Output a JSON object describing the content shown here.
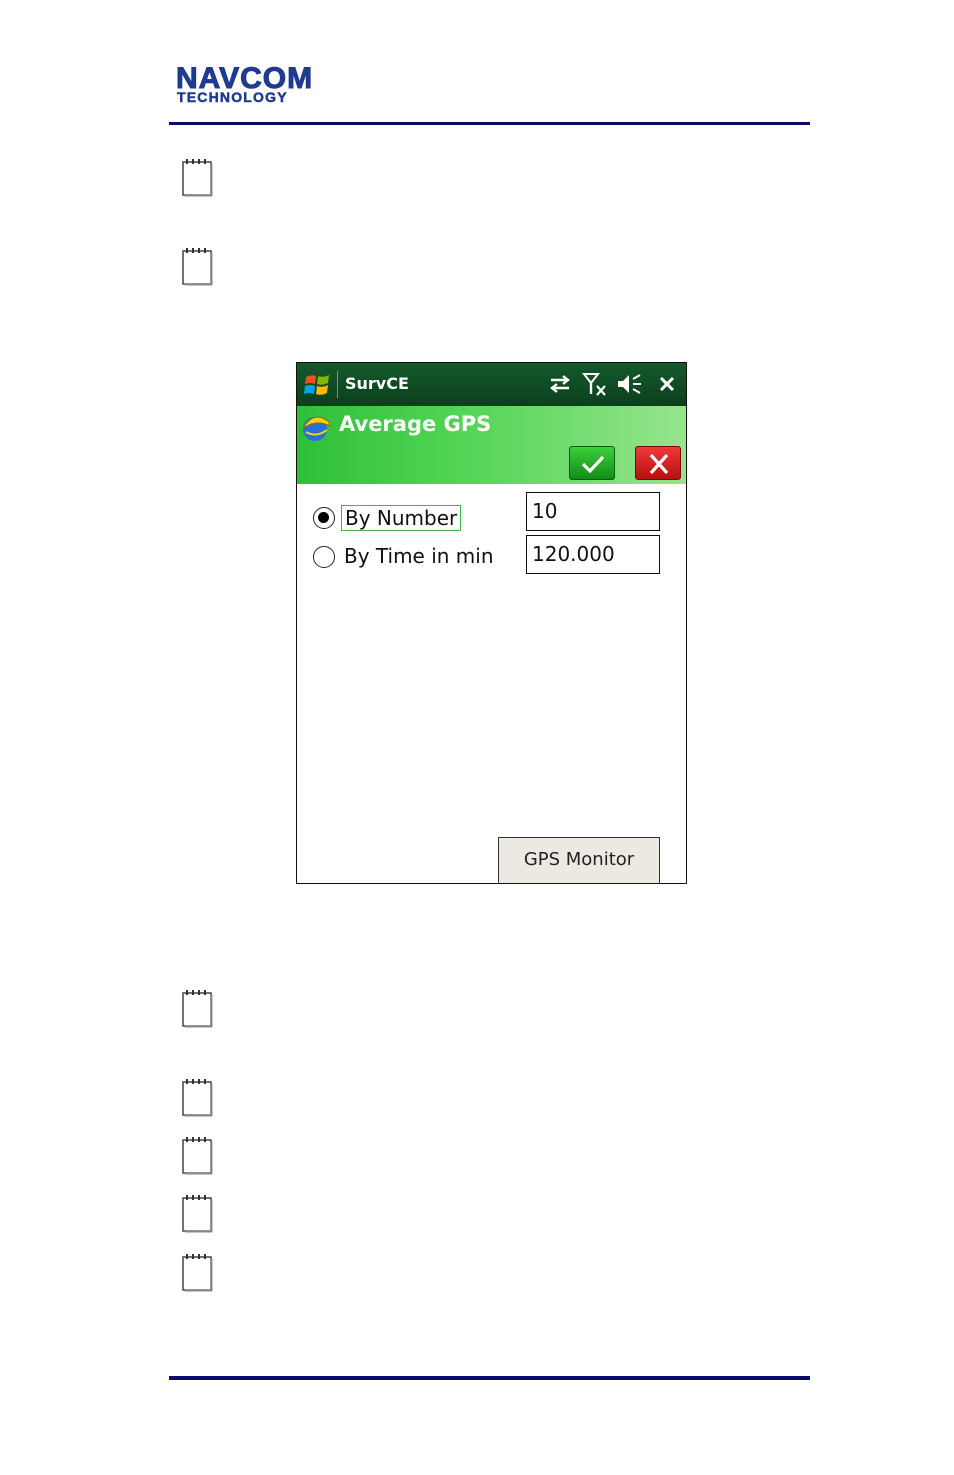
{
  "page": {
    "logo": {
      "line1": "NAVCOM",
      "line2": "TECHNOLOGY"
    },
    "note_icons": [
      "notepad-icon",
      "notepad-icon",
      "notepad-icon",
      "notepad-icon",
      "notepad-icon",
      "notepad-icon"
    ],
    "rule_color": "#0b0b6e"
  },
  "device": {
    "statusbar": {
      "app_title": "SurvCE",
      "icons": [
        "windows-start-icon",
        "connectivity-icon",
        "no-signal-icon",
        "speaker-muted-icon",
        "close-icon"
      ]
    },
    "form": {
      "title": "Average GPS",
      "ok_icon": "checkmark-icon",
      "cancel_icon": "x-icon"
    },
    "options": [
      {
        "label": "By Number",
        "selected": true,
        "value": "10"
      },
      {
        "label": "By Time in min",
        "selected": false,
        "value": "120.000"
      }
    ],
    "gps_monitor_label": "GPS Monitor"
  }
}
